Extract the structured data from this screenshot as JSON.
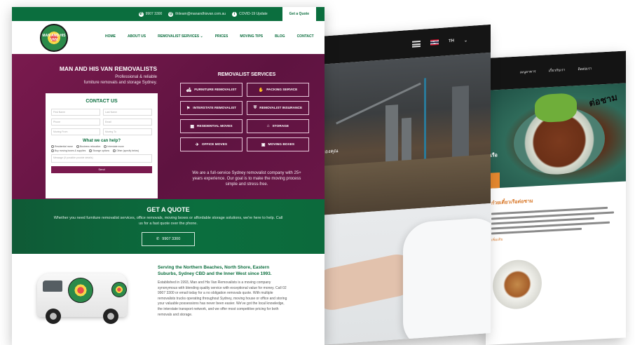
{
  "removalist": {
    "topbar": {
      "phone": "9907 3300",
      "email": "thiteam@manandhisvan.com.au",
      "covid": "COVID-19 Update",
      "quote_button": "Get a Quote"
    },
    "logo_text": "MAN AND HIS VAN",
    "nav": [
      "HOME",
      "ABOUT US",
      "REMOVALIST SERVICES ⌄",
      "PRICES",
      "MOVING TIPS",
      "BLOG",
      "CONTACT"
    ],
    "hero": {
      "title": "MAN AND HIS VAN REMOVALISTS",
      "subtitle_1": "Professional & reliable",
      "subtitle_2": "furniture removals and storage Sydney."
    },
    "contact_form": {
      "title": "CONTACT US",
      "fields": [
        "First Name",
        "Last Name",
        "Phone",
        "Email",
        "Moving From",
        "Moving To"
      ],
      "help_title": "What we can help?",
      "options": [
        "Residential move",
        "Business relocation",
        "Interstate move",
        "Buy moving boxes & supplies",
        "Storage options",
        "Other (specify below)"
      ],
      "message_placeholder": "Message (if possible provide details)",
      "send_label": "Send"
    },
    "services": {
      "title": "REMOVALIST SERVICES",
      "items": [
        {
          "label": "FURNITURE REMOVALIST",
          "icon": "🛋"
        },
        {
          "label": "PACKING SERVICE",
          "icon": "✋"
        },
        {
          "label": "INTERSTATE REMOVALIST",
          "icon": "⚑"
        },
        {
          "label": "REMOVALIST INSURANCE",
          "icon": "⛨"
        },
        {
          "label": "RESIDENTIAL MOVES",
          "icon": "▦"
        },
        {
          "label": "STORAGE",
          "icon": "⌂"
        },
        {
          "label": "OFFICE MOVES",
          "icon": "✈"
        },
        {
          "label": "MOVING BOXES",
          "icon": "▣"
        }
      ],
      "description": "We are a full-service Sydney removalist company with 25+ years experience. Our goal is to make the moving process simple and stress-free."
    },
    "get_quote": {
      "title": "GET A QUOTE",
      "description": "Whether you need furniture removalist services, office removals, moving boxes or affordable storage solutions, we're here to help. Call us for a fast quote over the phone.",
      "phone_button": "9907 3300"
    },
    "about": {
      "title": "Serving the Northern Beaches, North Shore, Eastern Suburbs, Sydney CBD and the Inner West since 1993.",
      "body": "Established in 1993, Man and His Van Removalists is a moving company synonymous with blending quality service with exceptional value for money. Call 02 9907 3300 or email today for a no obligation removals quote. With multiple removalists trucks operating throughout Sydney, moving house or office and storing your valuable possessions has never been easier. We've got the local knowledge, the interstate transport network, and we offer most competitive pricing for both removals and storage."
    }
  },
  "construction": {
    "lang": "TH",
    "hero_text": "ของคุณ"
  },
  "restaurant": {
    "nav": [
      "เมนูอาหาร",
      "เกี่ยวกับเรา",
      "ติดต่อเรา"
    ],
    "logo": "ต่อชาม",
    "hero_tail": "บเรือ",
    "section_title": "ก๋วยเตี๋ยวเรือต่อชาม",
    "link_text": "เพิ่มเติม"
  },
  "colors": {
    "green": "#0b6e3e",
    "maroon": "#7a1a4e",
    "orange": "#d97a2c"
  }
}
